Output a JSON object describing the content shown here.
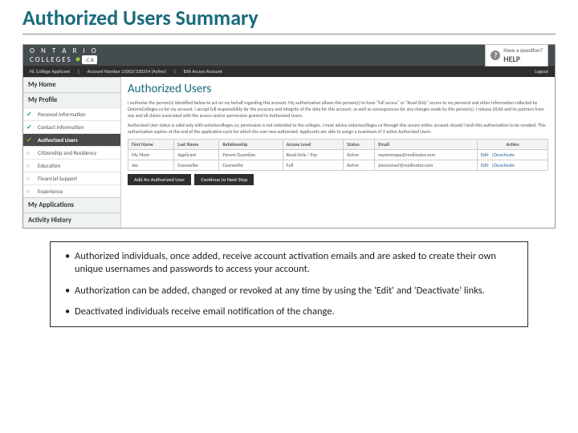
{
  "slide_title": "Authorized Users Summary",
  "topbar": {
    "logo_top": "O N T A R I O",
    "logo_bottom": "COLLEGES",
    "logo_ca": ".CA",
    "help_small": "Have a question?",
    "help_big": "HELP"
  },
  "subbar": {
    "greeting": "Hi, College Applicant",
    "acct": "Account Number 21003/330314  (Active)",
    "edit": "Edit Access Account",
    "logout": "Logout"
  },
  "sidebar": {
    "home": "My Home",
    "profile": "My Profile",
    "items": [
      "Personal Information",
      "Contact Information",
      "Authorized Users",
      "Citizenship and Residency",
      "Education",
      "Financial Support",
      "Experience"
    ],
    "apps": "My Applications",
    "activity": "Activity History"
  },
  "content": {
    "heading": "Authorized Users",
    "p1": "I authorize the person(s) identified below to act on my behalf regarding this account. My authorization allows this person(s) to have \"full access\" or \"Read Only\" access to my personal and other information collected by OntarioColleges.ca for my account. I accept full responsibility for the accuracy and integrity of the data for this account, as well as consequences for any changes made by this person(s). I release OCAS and its partners from any and all claims associated with the access and/or permission granted to Authorized Users.",
    "p2": "Authorized User status is valid only with ontariocolleges.ca; permission is not extended to the colleges. I must advise ontariocolleges.ca through this secure online account should I wish this authorization to be revoked. This authorization expires at the end of the application cycle for which the user was authorized. Applicants are able to assign a maximum of 3 active Authorized Users.",
    "headers": [
      "First Name",
      "Last Name",
      "Relationship",
      "Access Level",
      "Status",
      "Email",
      "Action"
    ],
    "rows": [
      {
        "fn": "My Mom",
        "ln": "Applicant",
        "rel": "Parent/Guardian",
        "lvl": "Read Only / Pay",
        "st": "Active",
        "em": "mymomapp@mailinator.com",
        "a1": "Edit",
        "a2": "Deactivate"
      },
      {
        "fn": "Joe",
        "ln": "Counsellor",
        "rel": "Counsellor",
        "lvl": "Full",
        "st": "Active",
        "em": "joecounsel@mailinator.com",
        "a1": "Edit",
        "a2": "Deactivate"
      }
    ],
    "btn1": "Add An Authorized User",
    "btn2": "Continue to Next Step"
  },
  "callout": {
    "b1": "Authorized individuals, once added, receive account activation emails and are asked to create their own unique usernames and passwords to access your account.",
    "b2": "Authorization can be added, changed or revoked at any time by using the 'Edit' and 'Deactivate' links.",
    "b3": "Deactivated individuals receive email notification of the change."
  }
}
